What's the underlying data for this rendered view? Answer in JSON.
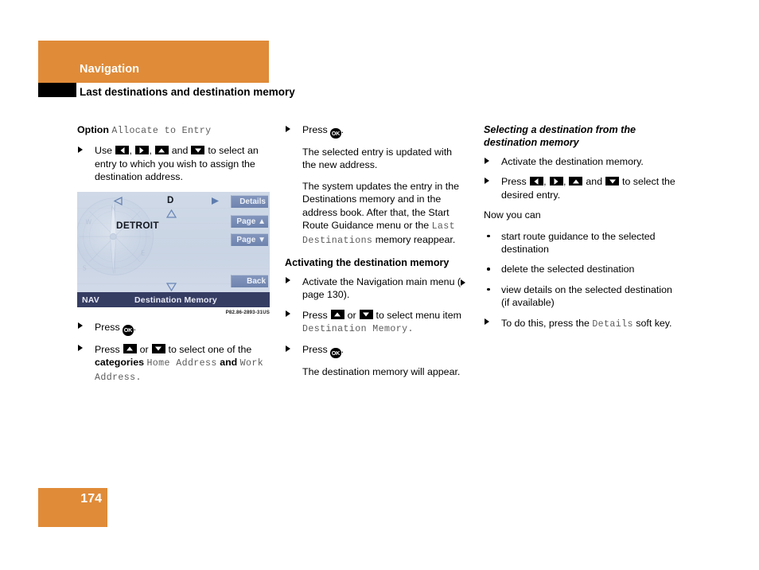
{
  "header": {
    "chapter": "Navigation",
    "section": "Last destinations and destination memory"
  },
  "page_number": "174",
  "column1": {
    "option_label": "Option",
    "option_value": "Allocate to Entry",
    "step1": {
      "pre": "Use",
      "mid1": ",",
      "mid2": ",",
      "and": "and",
      "post": "to select an entry to which you wish to assign the destination address."
    },
    "step2": {
      "press": "Press",
      "period": "."
    },
    "step3": {
      "press": "Press",
      "or": "or",
      "tail": "to select one of the",
      "categories_label": "categories",
      "cat1": "Home Address",
      "and": "and",
      "cat2": "Work Address",
      "period": "."
    }
  },
  "figure": {
    "letter": "D",
    "city": "DETROIT",
    "softkeys": [
      "Details",
      "Page ▲",
      "Page ▼",
      "Back"
    ],
    "status_left": "NAV",
    "status_title": "Destination Memory",
    "caption": "P82.86-2893-31US"
  },
  "column2": {
    "step1": {
      "press": "Press",
      "period": "."
    },
    "para1": "The selected entry is updated with the new address.",
    "para2_a": "The system updates the entry in the Destinations memory and in the address book. After that, the Start Route Guidance menu or the ",
    "para2_mono1": "Last Destinations",
    "para2_b": " memory reappear.",
    "heading": "Activating the destination memory",
    "step2_a": "Activate the Navigation main menu (",
    "step2_ref": "page 130",
    "step2_b": ").",
    "step3": {
      "press": "Press",
      "or": "or",
      "tail": "to select menu item",
      "mono": "Destination Memory",
      "period": "."
    },
    "step4": {
      "press": "Press",
      "period": "."
    },
    "para3": "The destination memory will appear."
  },
  "column3": {
    "heading": "Selecting a destination from the destination memory",
    "step1": "Activate the destination memory.",
    "step2": {
      "press": "Press",
      "mid1": ",",
      "mid2": ",",
      "and": "and",
      "tail": "to select the desired entry."
    },
    "lead_in": "Now you can",
    "bullets": [
      "start route guidance to the selected destination",
      "delete the selected destination",
      "view details on the selected destination (if available)"
    ],
    "step3_a": "To do this, press the ",
    "step3_mono": "Details",
    "step3_b": " soft key."
  },
  "colors": {
    "brand_orange": "#e08b38",
    "nav_statusbar": "#363d63",
    "softkey_blue": "#7287b0",
    "mono_gray": "#5b5b5b"
  }
}
